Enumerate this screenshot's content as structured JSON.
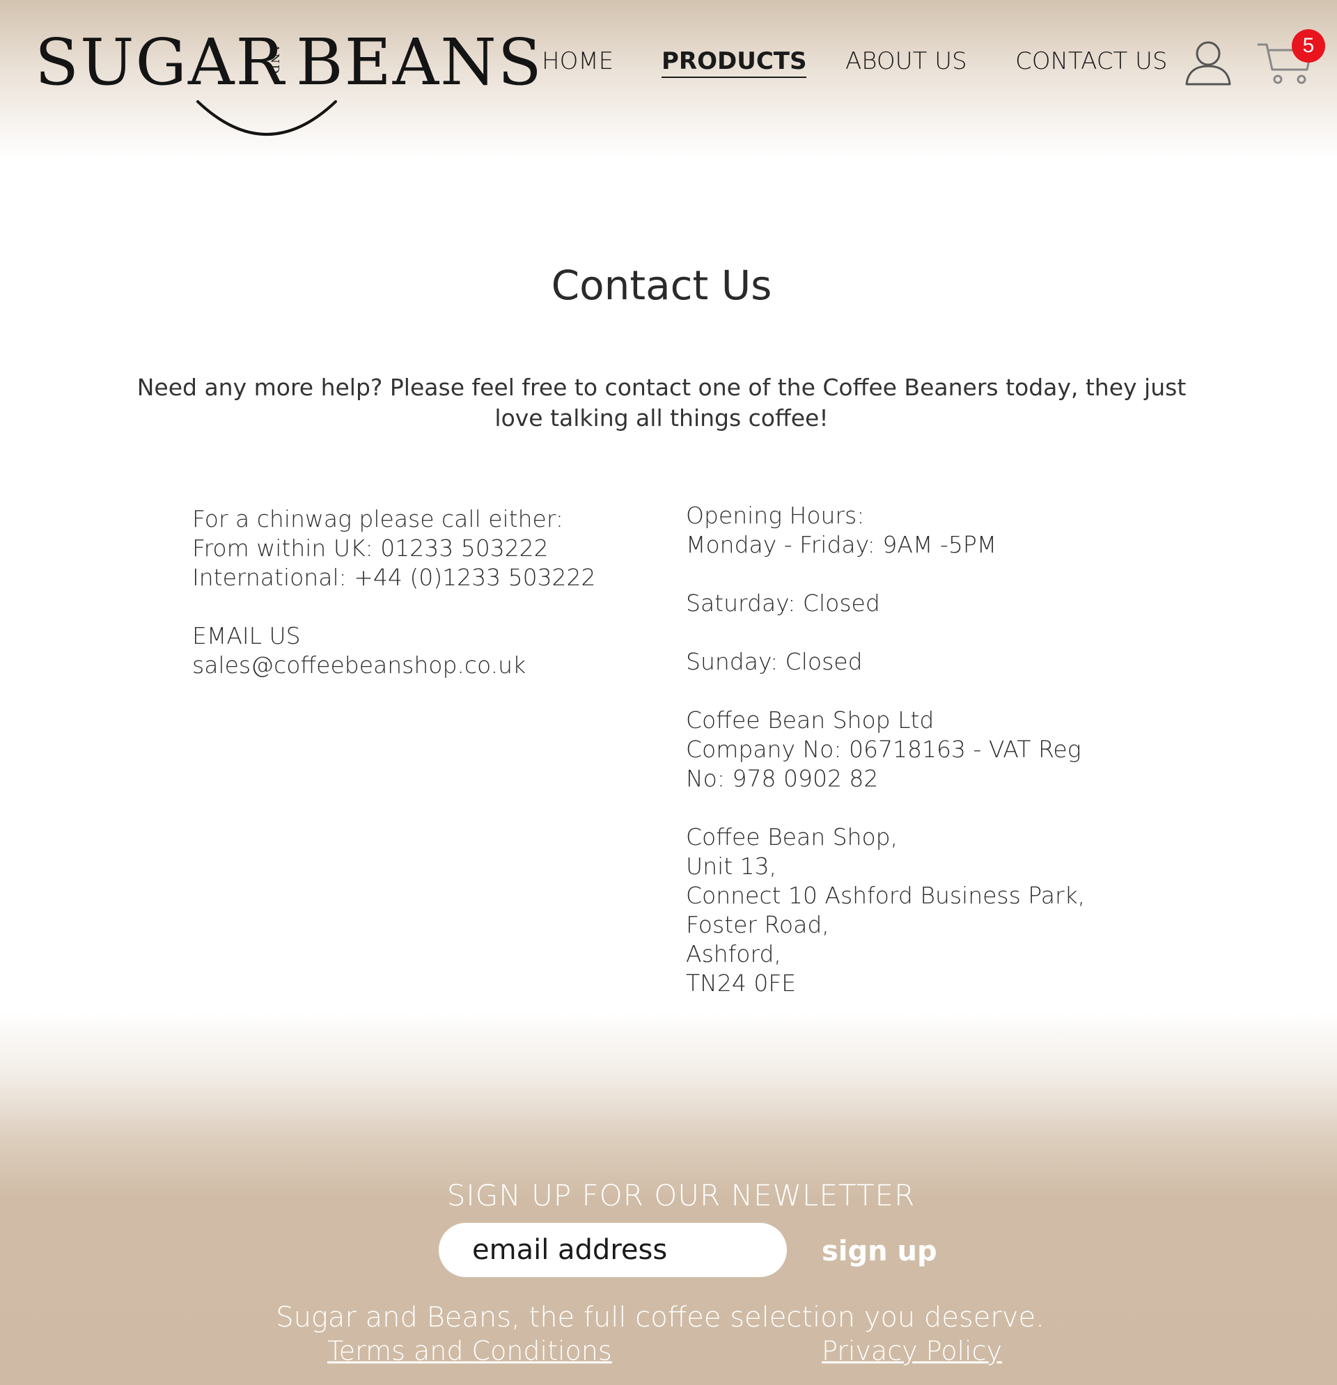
{
  "brand": {
    "logo_left": "SUGAR",
    "logo_and": "AND",
    "logo_right": "BEANS"
  },
  "nav": {
    "items": [
      {
        "label": "HOME"
      },
      {
        "label": "PRODUCTS",
        "active": true
      },
      {
        "label": "ABOUT US"
      },
      {
        "label": "CONTACT US"
      }
    ],
    "user_icon": "user-icon",
    "cart_icon": "cart-icon",
    "cart_count": "5"
  },
  "page": {
    "title": "Contact Us",
    "intro": "Need any more help? Please feel free to contact one of the Coffee Beaners today, they just love talking all things coffee!"
  },
  "contact": {
    "call_heading": "For a chinwag please call either:",
    "uk_phone": "From within UK: 01233 503222",
    "intl_phone": "International: +44 (0)1233 503222",
    "email_heading": "EMAIL US",
    "email": "sales@coffeebeanshop.co.uk"
  },
  "hours": {
    "heading": "Opening Hours:",
    "weekdays": "Monday - Friday: 9AM -5PM",
    "saturday": "Saturday: Closed",
    "sunday": "Sunday: Closed"
  },
  "company": {
    "name": "Coffee Bean Shop Ltd",
    "reg_line1": "Company No: 06718163 - VAT Reg",
    "reg_line2": "No: 978 0902 82",
    "address": [
      "Coffee Bean Shop,",
      "Unit 13,",
      "Connect 10 Ashford Business Park,",
      "Foster Road,",
      "Ashford,",
      "TN24 0FE"
    ]
  },
  "footer": {
    "newsletter_title": "SIGN UP FOR OUR NEWLETTER",
    "email_placeholder": "email address",
    "signup_label": "sign up",
    "tagline": "Sugar and Beans, the full coffee selection you deserve.",
    "terms_label": "Terms and Conditions",
    "privacy_label": "Privacy Policy"
  },
  "colors": {
    "header_tan": "#d3c3b0",
    "footer_tan": "#cfbba5",
    "badge_red": "#e8141e",
    "text_dark": "#2b2b2b"
  }
}
